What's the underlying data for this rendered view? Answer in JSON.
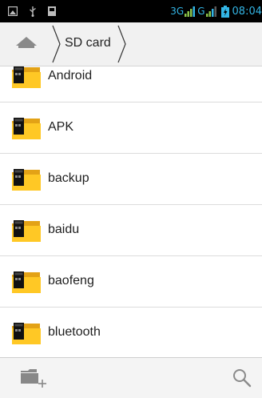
{
  "status_bar": {
    "network_label": "3G",
    "secondary_network_label": "G",
    "time": "08:04",
    "accent_color": "#33b5e5"
  },
  "path_bar": {
    "home_icon": "home-icon",
    "crumbs": [
      "SD card"
    ]
  },
  "folders": [
    {
      "name": "Android",
      "icon": "sd-folder-icon"
    },
    {
      "name": "APK",
      "icon": "sd-folder-icon"
    },
    {
      "name": "backup",
      "icon": "sd-folder-icon"
    },
    {
      "name": "baidu",
      "icon": "sd-folder-icon"
    },
    {
      "name": "baofeng",
      "icon": "sd-folder-icon"
    },
    {
      "name": "bluetooth",
      "icon": "sd-folder-icon"
    }
  ],
  "bottom_bar": {
    "new_folder_icon": "new-folder-icon",
    "search_icon": "search-icon"
  }
}
